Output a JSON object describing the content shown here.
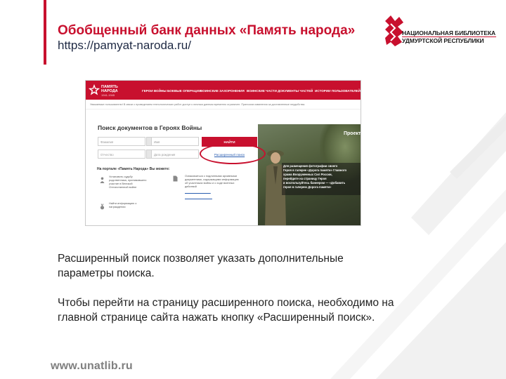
{
  "slide": {
    "title": "Обобщенный банк данных «Память народа»",
    "url": "https://pamyat-naroda.ru/",
    "logo": {
      "line1": "НАЦИОНАЛЬНАЯ БИБЛИОТЕКА",
      "line2": "УДМУРТСКОЙ РЕСПУБЛИКИ",
      "icon": "udmurt-library-emblem-icon"
    },
    "footer": "www.unatlib.ru",
    "accent_color": "#c8102e",
    "paragraphs": [
      [
        "Расширенный поиск позволяет указать дополнительные",
        "параметры поиска."
      ],
      [
        "Чтобы перейти на страницу расширенного поиска, необходимо на",
        "главной странице сайта нажать кнопку «Расширенный поиск»."
      ]
    ]
  },
  "screenshot": {
    "logo": {
      "line1": "ПАМЯТЬ",
      "line2": "НАРОДА",
      "line3": "1941-1945",
      "icon": "red-star-icon"
    },
    "nav": [
      "ГЕРОИ ВОЙНЫ",
      "БОЕВЫЕ ОПЕРАЦИИ",
      "ВОИНСКИЕ ЗАХОРОНЕНИЯ",
      "ВОИНСКИЕ ЧАСТИ",
      "ДОКУМЕНТЫ ЧАСТЕЙ",
      "ИСТОРИИ ПОЛЬЗОВАТЕЛЕЙ"
    ],
    "notice": "Уважаемые пользователи! В связи с проведением технологических работ доступ к личным данным временно ограничен. Приносим извинения за доставленные неудобства.",
    "search": {
      "heading": "Поиск документов в Героях Войны",
      "placeholders": [
        "Фамилия",
        "Имя",
        "Отчество",
        "Дата рождения"
      ],
      "find_button": "НАЙТИ",
      "advanced_button": "Расширенный поиск"
    },
    "portal": {
      "heading": "На портале «Память Народа» Вы можете:",
      "features": [
        {
          "lines": [
            "Установить судьбу",
            "родственника, принимавшего",
            "участие в Великой",
            "Отечественной войне"
          ],
          "icon": "person-icon"
        },
        {
          "lines": [
            "Ознакомиться с подлинными архивными",
            "документами, содержащими информацию",
            "об участниках войны и о ходе военных",
            "действий"
          ],
          "icon": "document-icon"
        },
        {
          "lines": [
            "Найти информацию о",
            "награждении"
          ],
          "icon": "medal-icon"
        }
      ]
    },
    "hero": {
      "title": "Проект",
      "caption": [
        "Для размещения фотографии своего",
        "Героя в галерее «Дорога памяти» Главного",
        "храма Вооруженных Сил России,",
        "перейдите на страницу Героя",
        "и воспользуйтесь баннером — «Добавить",
        "героя в галерею Дорога памяти»"
      ]
    }
  }
}
